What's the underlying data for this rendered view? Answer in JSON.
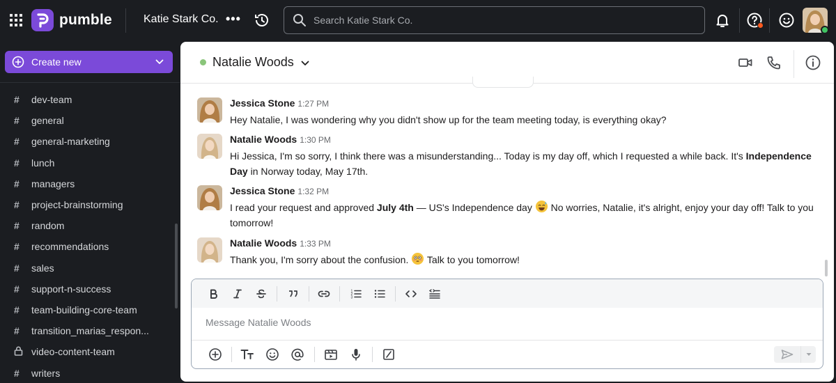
{
  "topbar": {
    "app_name": "pumble",
    "workspace_name": "Katie Stark Co.",
    "workspace_more": "•••",
    "search_placeholder": "Search Katie Stark Co.",
    "icons": [
      "apps-grid-icon",
      "history-icon",
      "search-icon",
      "bell-icon",
      "help-icon",
      "emoji-status-icon"
    ]
  },
  "sidebar": {
    "create_label": "Create new",
    "channels": [
      {
        "name": "dev-team",
        "icon": "#"
      },
      {
        "name": "general",
        "icon": "#"
      },
      {
        "name": "general-marketing",
        "icon": "#"
      },
      {
        "name": "lunch",
        "icon": "#"
      },
      {
        "name": "managers",
        "icon": "#"
      },
      {
        "name": "project-brainstorming",
        "icon": "#"
      },
      {
        "name": "random",
        "icon": "#"
      },
      {
        "name": "recommendations",
        "icon": "#"
      },
      {
        "name": "sales",
        "icon": "#"
      },
      {
        "name": "support-n-success",
        "icon": "#"
      },
      {
        "name": "team-building-core-team",
        "icon": "#"
      },
      {
        "name": "transition_marias_respon...",
        "icon": "#"
      },
      {
        "name": "video-content-team",
        "icon": "lock"
      },
      {
        "name": "writers",
        "icon": "#"
      }
    ]
  },
  "chat": {
    "title": "Natalie Woods",
    "presence": "online",
    "messages": [
      {
        "author": "Jessica Stone",
        "time": "1:27 PM",
        "text": "Hey Natalie, I was wondering why you didn't show up for the team meeting today, is everything okay?"
      },
      {
        "author": "Natalie Woods",
        "time": "1:30 PM",
        "text_a": "Hi Jessica, I'm so sorry, I think there was a misunderstanding... Today is my day off, which I requested a while back. It's ",
        "bold": "Independence Day",
        "text_b": " in Norway today, May 17th."
      },
      {
        "author": "Jessica Stone",
        "time": "1:32 PM",
        "text_a": "I read your request and approved ",
        "bold": "July 4th",
        "text_b": " — US's Independence day ",
        "emoji": "sweat-smile-emoji",
        "text_c": " No worries, Natalie, it's alright, enjoy your day off! Talk to you tomorrow!"
      },
      {
        "author": "Natalie Woods",
        "time": "1:33 PM",
        "text_a": "Thank you, I'm sorry about the confusion. ",
        "emoji": "flushed-emoji",
        "text_b": " Talk to you tomorrow!"
      }
    ]
  },
  "composer": {
    "placeholder": "Message Natalie Woods",
    "format_tools": [
      "bold",
      "italic",
      "strikethrough",
      "quote",
      "link",
      "numbered-list",
      "bulleted-list",
      "code",
      "code-block"
    ],
    "action_tools": [
      "attach",
      "text-format",
      "emoji",
      "mention",
      "video-clip",
      "microphone",
      "slash-command"
    ]
  },
  "colors": {
    "brand": "#7b4ad9",
    "dark_bg": "#1b1d21",
    "presence_online": "#8ac57a",
    "notification_dot": "#ff5a1f"
  }
}
